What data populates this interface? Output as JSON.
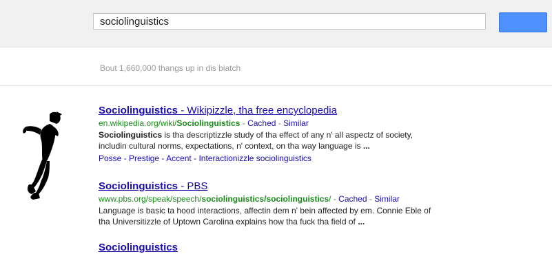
{
  "search": {
    "query": "sociolinguistics"
  },
  "stats": {
    "text": "Bout 1,660,000 thangs up in dis biatch"
  },
  "colors": {
    "link": "#1a0dab",
    "url_green": "#1a8a1a",
    "button_blue": "#4d90fe",
    "stats_gray": "#999999"
  },
  "results": [
    {
      "title_main": "Sociolinguistics",
      "title_rest": " - Wikipizzle, tha free encyclopedia",
      "url_prefix": "en.wikipedia.org/wiki/",
      "url_bold": "Sociolinguistics",
      "url_suffix": "",
      "cached": "Cached",
      "similar": "Similar",
      "snippet_line1_bold": "Sociolinguistics",
      "snippet_line1_rest": " is tha descriptizzle study of tha effect of any n' all aspectz of society,",
      "snippet_line2": "includin cultural norms, expectations, n' context, on tha way language is ",
      "snippet_line2_ellipsis": "...",
      "sitelinks": [
        "Posse",
        "Prestige",
        "Accent",
        "Interactionizzle sociolinguistics"
      ]
    },
    {
      "title_main": "Sociolinguistics",
      "title_rest": " - PBS",
      "url_prefix": "www.pbs.org/speak/speech/",
      "url_bold": "sociolinguistics/sociolinguistics",
      "url_suffix": "/",
      "cached": "Cached",
      "similar": "Similar",
      "snippet_line1": "Language is basic ta hood interactions, affectin dem n' bein affected by em. Connie Eble of",
      "snippet_line2": "tha Universitizzle of Uptown Carolina explains how tha fuck tha field of ",
      "snippet_line2_ellipsis": "..."
    },
    {
      "title_main": "Sociolinguistics"
    }
  ],
  "icons": {
    "figure": "dancing-figure-icon"
  }
}
